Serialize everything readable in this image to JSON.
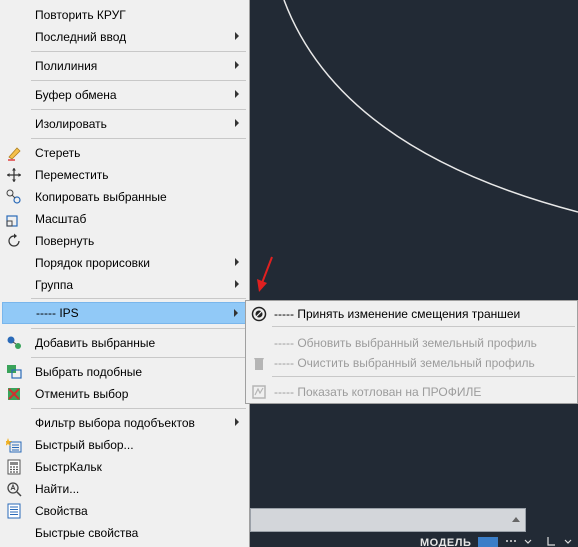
{
  "context_menu": {
    "items": [
      {
        "label": "Повторить КРУГ"
      },
      {
        "label": "Последний ввод"
      },
      {
        "label": "Полилиния"
      },
      {
        "label": "Буфер обмена"
      },
      {
        "label": "Изолировать"
      },
      {
        "label": "Стереть"
      },
      {
        "label": "Переместить"
      },
      {
        "label": "Копировать выбранные"
      },
      {
        "label": "Масштаб"
      },
      {
        "label": "Повернуть"
      },
      {
        "label": "Порядок прорисовки"
      },
      {
        "label": "Группа"
      },
      {
        "label": "----- IPS"
      },
      {
        "label": "Добавить выбранные"
      },
      {
        "label": "Выбрать подобные"
      },
      {
        "label": "Отменить выбор"
      },
      {
        "label": "Фильтр выбора подобъектов"
      },
      {
        "label": "Быстрый выбор..."
      },
      {
        "label": "БыстрКальк"
      },
      {
        "label": "Найти..."
      },
      {
        "label": "Свойства"
      },
      {
        "label": "Быстрые свойства"
      }
    ]
  },
  "submenu": {
    "items": [
      {
        "label": "----- Принять изменение смещения траншеи"
      },
      {
        "label": "----- Обновить выбранный земельный профиль"
      },
      {
        "label": "----- Очистить выбранный земельный профиль"
      },
      {
        "label": "----- Показать котлован на ПРОФИЛЕ"
      }
    ]
  },
  "status_bar": {
    "model_label": "МОДЕЛЬ"
  },
  "colors": {
    "canvas_bg": "#222a35",
    "menu_bg": "#f0f0f0",
    "highlight": "#91c9f7",
    "disabled_text": "#9c9c9c",
    "annotation_arrow": "#e02020"
  }
}
